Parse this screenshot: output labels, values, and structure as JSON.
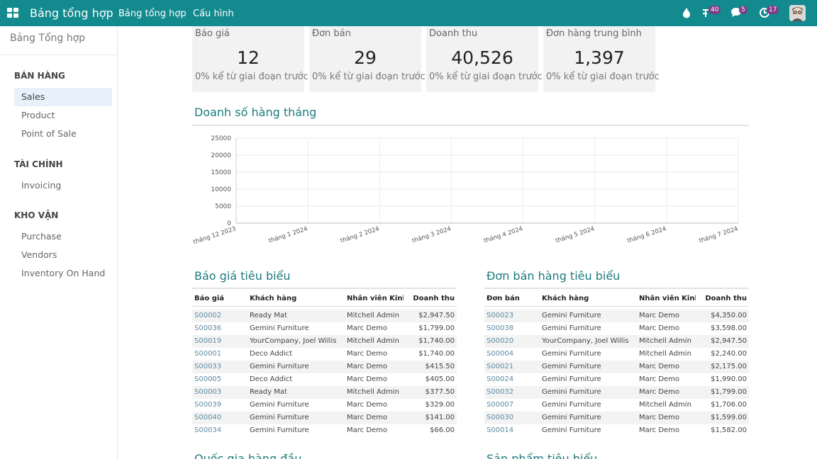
{
  "topbar": {
    "brand": "Bảng tổng hợp",
    "nav": [
      "Bảng tổng hợp",
      "Cấu hình"
    ],
    "icons": {
      "drop": "water-drop-icon",
      "activity": "activity-icon",
      "chat": "chat-icon",
      "clock": "clock-icon"
    },
    "badges": {
      "activity": "40",
      "chat": "5",
      "clock": "17"
    }
  },
  "sidebar": {
    "title": "Bảng Tổng hợp",
    "sections": [
      {
        "title": "BÁN HÀNG",
        "items": [
          "Sales",
          "Product",
          "Point of Sale"
        ]
      },
      {
        "title": "TÀI CHÍNH",
        "items": [
          "Invoicing"
        ]
      },
      {
        "title": "KHO VẬN",
        "items": [
          "Purchase",
          "Vendors",
          "Inventory On Hand"
        ]
      }
    ],
    "active_item": "Sales"
  },
  "kpis": [
    {
      "label": "Báo giá",
      "value": "12",
      "sub": "0% kể từ giai đoạn trước"
    },
    {
      "label": "Đơn bán",
      "value": "29",
      "sub": "0% kể từ giai đoạn trước"
    },
    {
      "label": "Doanh thu",
      "value": "40,526",
      "sub": "0% kể từ giai đoạn trước"
    },
    {
      "label": "Đơn hàng trung bình",
      "value": "1,397",
      "sub": "0% kể từ giai đoạn trước"
    }
  ],
  "monthly": {
    "title": "Doanh số hàng tháng"
  },
  "chart_data": {
    "type": "line",
    "categories": [
      "tháng 12 2023",
      "tháng 1 2024",
      "tháng 2 2024",
      "tháng 3 2024",
      "tháng 4 2024",
      "tháng 5 2024",
      "tháng 6 2024",
      "tháng 7 2024"
    ],
    "yticks": [
      "0",
      "5000",
      "10000",
      "15000",
      "20000",
      "25000"
    ],
    "ylim": [
      0,
      25000
    ],
    "grid": true,
    "series": []
  },
  "quotes": {
    "title": "Báo giá tiêu biểu",
    "columns": [
      "Báo giá",
      "Khách hàng",
      "Nhân viên Kinh d",
      "Doanh thu"
    ],
    "rows": [
      [
        "S00002",
        "Ready Mat",
        "Mitchell Admin",
        "$2,947.50"
      ],
      [
        "S00036",
        "Gemini Furniture",
        "Marc Demo",
        "$1,799.00"
      ],
      [
        "S00019",
        "YourCompany, Joel Willis",
        "Mitchell Admin",
        "$1,740.00"
      ],
      [
        "S00001",
        "Deco Addict",
        "Marc Demo",
        "$1,740.00"
      ],
      [
        "S00033",
        "Gemini Furniture",
        "Marc Demo",
        "$415.50"
      ],
      [
        "S00005",
        "Deco Addict",
        "Marc Demo",
        "$405.00"
      ],
      [
        "S00003",
        "Ready Mat",
        "Mitchell Admin",
        "$377.50"
      ],
      [
        "S00039",
        "Gemini Furniture",
        "Marc Demo",
        "$329.00"
      ],
      [
        "S00040",
        "Gemini Furniture",
        "Marc Demo",
        "$141.00"
      ],
      [
        "S00034",
        "Gemini Furniture",
        "Marc Demo",
        "$66.00"
      ]
    ]
  },
  "orders": {
    "title": "Đơn bán hàng tiêu biểu",
    "columns": [
      "Đơn bán",
      "Khách hàng",
      "Nhân viên Kinh d",
      "Doanh thu"
    ],
    "rows": [
      [
        "S00023",
        "Gemini Furniture",
        "Marc Demo",
        "$4,350.00"
      ],
      [
        "S00038",
        "Gemini Furniture",
        "Marc Demo",
        "$3,598.00"
      ],
      [
        "S00020",
        "YourCompany, Joel Willis",
        "Mitchell Admin",
        "$2,947.50"
      ],
      [
        "S00004",
        "Gemini Furniture",
        "Mitchell Admin",
        "$2,240.00"
      ],
      [
        "S00021",
        "Gemini Furniture",
        "Marc Demo",
        "$2,175.00"
      ],
      [
        "S00024",
        "Gemini Furniture",
        "Marc Demo",
        "$1,990.00"
      ],
      [
        "S00032",
        "Gemini Furniture",
        "Marc Demo",
        "$1,799.00"
      ],
      [
        "S00007",
        "Gemini Furniture",
        "Mitchell Admin",
        "$1,706.00"
      ],
      [
        "S00030",
        "Gemini Furniture",
        "Marc Demo",
        "$1,599.00"
      ],
      [
        "S00014",
        "Gemini Furniture",
        "Marc Demo",
        "$1,582.00"
      ]
    ]
  },
  "bottom": {
    "left_title": "Quốc gia hàng đầu",
    "right_title": "Sản phẩm tiêu biểu"
  }
}
